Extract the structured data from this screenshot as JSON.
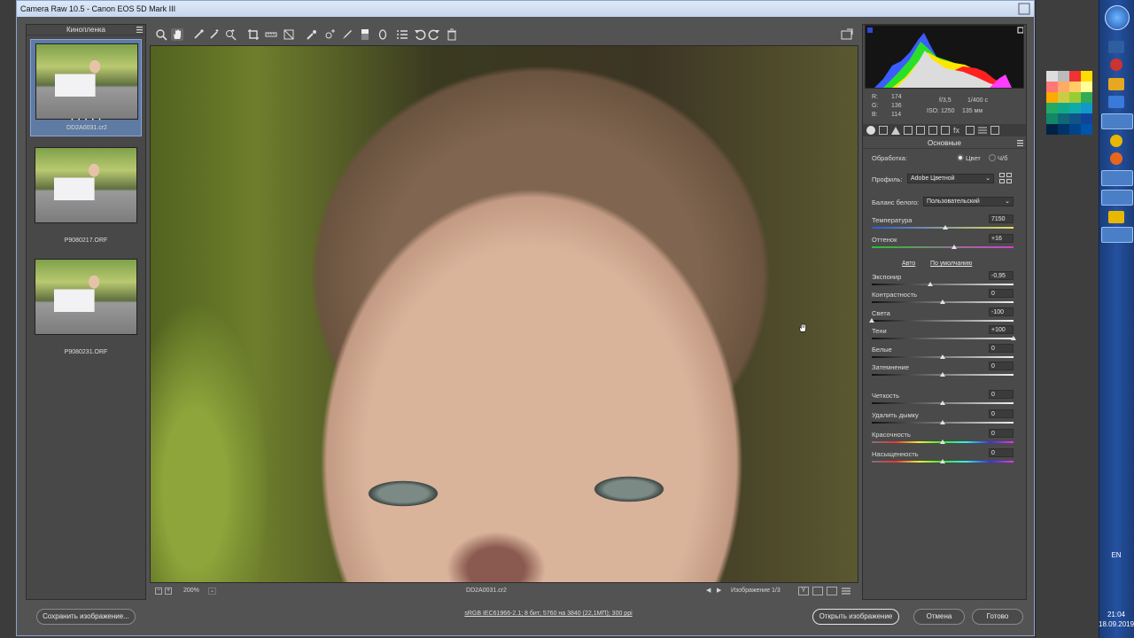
{
  "window": {
    "title": "Camera Raw 10.5  -  Canon EOS 5D Mark III"
  },
  "filmstrip": {
    "title": "Кинопленка",
    "items": [
      {
        "filename": "DD2A0031.cr2",
        "selected": true
      },
      {
        "filename": "P9080217.ORF",
        "selected": false
      },
      {
        "filename": "P9080231.ORF",
        "selected": false
      }
    ]
  },
  "toolbar": {
    "tools": [
      "zoom-icon",
      "hand-icon",
      "white-balance-icon",
      "color-sampler-icon",
      "target-adjust-icon",
      "crop-icon",
      "straighten-icon",
      "transform-icon",
      "spot-removal-icon",
      "red-eye-icon",
      "adjustment-brush-icon",
      "graduated-filter-icon",
      "radial-filter-icon",
      "presets-icon",
      "rotate-left-icon",
      "rotate-right-icon",
      "trash-icon"
    ]
  },
  "status": {
    "zoom": "200%",
    "filename": "DD2A0031.cr2",
    "image_counter": "Изображение 1/3"
  },
  "exif": {
    "r_label": "R:",
    "r_value": "174",
    "g_label": "G:",
    "g_value": "136",
    "b_label": "B:",
    "b_value": "114",
    "aperture": "f/3,5",
    "shutter": "1/400 с",
    "iso": "ISO: 1250",
    "focal": "135 мм"
  },
  "panel": {
    "header": "Основные",
    "treatment_label": "Обработка:",
    "treatment_color": "Цвет",
    "treatment_bw": "Ч/б",
    "profile_label": "Профиль:",
    "profile_value": "Adobe Цветной",
    "wb_label": "Баланс белого:",
    "wb_value": "Пользовательский",
    "auto_link": "Авто",
    "default_link": "По умолчанию",
    "sliders": [
      {
        "label": "Температура",
        "value": "7150",
        "pos": 0.52
      },
      {
        "label": "Оттенок",
        "value": "+16",
        "pos": 0.58
      },
      {
        "label": "Экспонир",
        "value": "-0,95",
        "pos": 0.41
      },
      {
        "label": "Контрастность",
        "value": "0",
        "pos": 0.5
      },
      {
        "label": "Света",
        "value": "-100",
        "pos": 0.0
      },
      {
        "label": "Тени",
        "value": "+100",
        "pos": 1.0
      },
      {
        "label": "Белые",
        "value": "0",
        "pos": 0.5
      },
      {
        "label": "Затемнение",
        "value": "0",
        "pos": 0.5
      },
      {
        "label": "Четкость",
        "value": "0",
        "pos": 0.5
      },
      {
        "label": "Удалить дымку",
        "value": "0",
        "pos": 0.5
      },
      {
        "label": "Красочность",
        "value": "0",
        "pos": 0.5
      },
      {
        "label": "Насыщенность",
        "value": "0",
        "pos": 0.5
      }
    ]
  },
  "footer": {
    "save_label": "Сохранить изображение...",
    "workflow_text": "sRGB IEC61966-2.1; 8 бит; 5760 на 3840 (22,1МП); 300 ppi",
    "open_label": "Открыть изображение",
    "cancel_label": "Отмена",
    "done_label": "Готово"
  },
  "taskbar": {
    "lang": "EN",
    "time": "21:04",
    "date": "18.09.2019"
  },
  "colors": {
    "accent": "#5f7aa3",
    "panel_bg": "#4a4a4a",
    "dialog_bg": "#535353"
  }
}
